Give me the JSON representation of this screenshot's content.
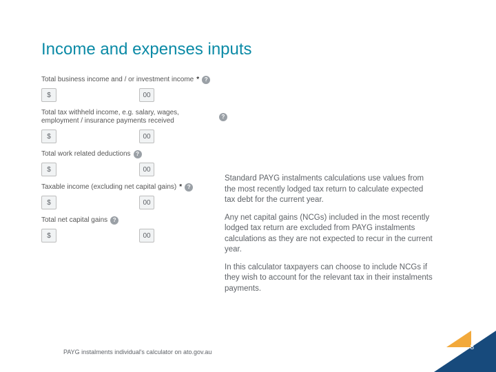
{
  "title": "Income and expenses inputs",
  "fields": [
    {
      "label": "Total business income and / or investment income",
      "required": true,
      "dollar": "$",
      "cents": "00"
    },
    {
      "label": "Total tax withheld income, e.g. salary, wages, employment / insurance payments received",
      "required": false,
      "dollar": "$",
      "cents": "00"
    },
    {
      "label": "Total work related deductions",
      "required": false,
      "dollar": "$",
      "cents": "00"
    },
    {
      "label": "Taxable income (excluding net capital gains)",
      "required": true,
      "dollar": "$",
      "cents": "00"
    },
    {
      "label": "Total net capital gains",
      "required": false,
      "dollar": "$",
      "cents": "00"
    }
  ],
  "paragraphs": [
    "Standard PAYG instalments calculations use values from the most recently lodged tax return to calculate expected tax debt for the current year.",
    "Any net capital gains (NCGs) included in the most recently lodged tax return are excluded from PAYG instalments calculations as they are not expected to recur in the current year.",
    "In this calculator taxpayers can choose to include NCGs if they wish to account for the relevant tax in their instalments payments."
  ],
  "footer": "PAYG instalments individual's calculator on ato.gov.au",
  "pagenum": "8",
  "help_glyph": "?",
  "req_glyph": "*"
}
